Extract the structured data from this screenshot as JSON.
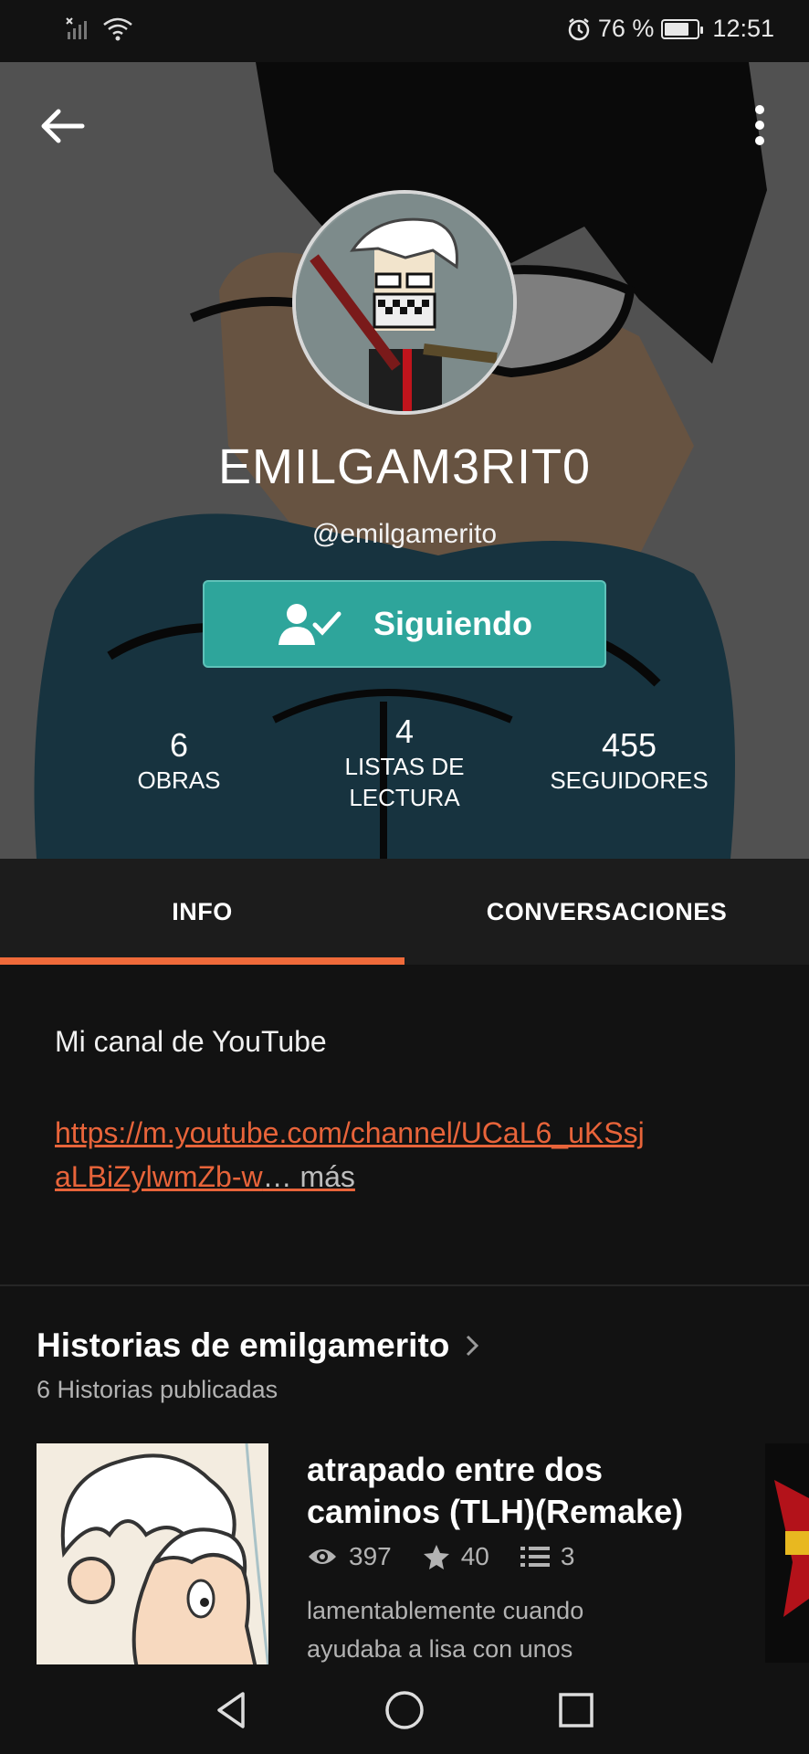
{
  "status_bar": {
    "battery_percent": "76 %",
    "battery_level": 0.76,
    "time": "12:51"
  },
  "profile": {
    "display_name": "EMILGAM3RIT0",
    "handle": "@emilgamerito",
    "follow_label": "Siguiendo",
    "stats": [
      {
        "value": "6",
        "label": "OBRAS"
      },
      {
        "value": "4",
        "label_line1": "LISTAS DE",
        "label_line2": "LECTURA"
      },
      {
        "value": "455",
        "label": "SEGUIDORES"
      }
    ]
  },
  "tabs": {
    "info": "INFO",
    "conversations": "CONVERSACIONES",
    "active": "info"
  },
  "info": {
    "text": "Mi canal de YouTube",
    "link": "https://m.youtube.com/channel/UCaL6_uKSsjaLBiZylwmZb-w",
    "more": "… más"
  },
  "stories": {
    "title": "Historias de emilgamerito",
    "subtitle": "6 Historias publicadas",
    "items": [
      {
        "title": "atrapado entre dos caminos (TLH)(Remake)",
        "reads": "397",
        "votes": "40",
        "parts": "3",
        "description": "lamentablemente cuando ayudaba a lisa con unos"
      }
    ]
  },
  "colors": {
    "accent": "#ef6a3a",
    "follow_button": "#2ea59b",
    "background": "#121212"
  }
}
